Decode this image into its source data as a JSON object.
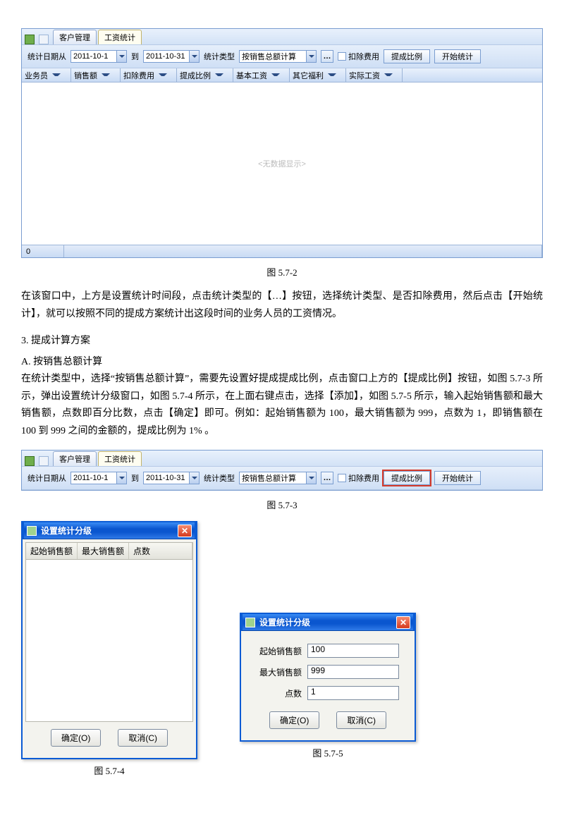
{
  "fig572": {
    "tabs": {
      "tab1": "客户管理",
      "tab2": "工资统计"
    },
    "toolbar": {
      "date_from_label": "统计日期从",
      "date_from": "2011-10-1",
      "to_label": "到",
      "date_to": "2011-10-31",
      "stat_type_label": "统计类型",
      "stat_type_value": "按销售总额计算",
      "deduct_label": "扣除费用",
      "ratio_btn": "提成比例",
      "start_btn": "开始统计"
    },
    "columns": [
      "业务员",
      "销售额",
      "扣除费用",
      "提成比例",
      "基本工资",
      "其它福利",
      "实际工资"
    ],
    "empty_text": "<无数据显示>",
    "status_value": "0",
    "caption": "图 5.7-2"
  },
  "para1": "在该窗口中，上方是设置统计时间段，点击统计类型的【…】按钮，选择统计类型、是否扣除费用，然后点击【开始统计】，就可以按照不同的提成方案统计出这段时间的业务人员的工资情况。",
  "h_3": "3. 提成计算方案",
  "h_A": "A. 按销售总额计算",
  "para2": "在统计类型中，选择“按销售总额计算”，需要先设置好提成提成比例，点击窗口上方的【提成比例】按钮，如图 5.7-3 所示，弹出设置统计分级窗口，如图 5.7-4 所示，在上面右键点击，选择【添加】，如图 5.7-5 所示，输入起始销售额和最大销售额，点数即百分比数，点击【确定】即可。例如：起始销售额为 100，最大销售额为 999，点数为 1，即销售额在 100 到 999 之间的金额的，提成比例为 1% 。",
  "fig573": {
    "caption": "图 5.7-3"
  },
  "dialog4": {
    "title": "设置统计分级",
    "cols": [
      "起始销售额",
      "最大销售额",
      "点数"
    ],
    "ok": "确定(O)",
    "cancel": "取消(C)",
    "caption": "图 5.7-4"
  },
  "dialog5": {
    "title": "设置统计分级",
    "f1_label": "起始销售额",
    "f1_value": "100",
    "f2_label": "最大销售额",
    "f2_value": "999",
    "f3_label": "点数",
    "f3_value": "1",
    "ok": "确定(O)",
    "cancel": "取消(C)",
    "caption": "图 5.7-5"
  }
}
